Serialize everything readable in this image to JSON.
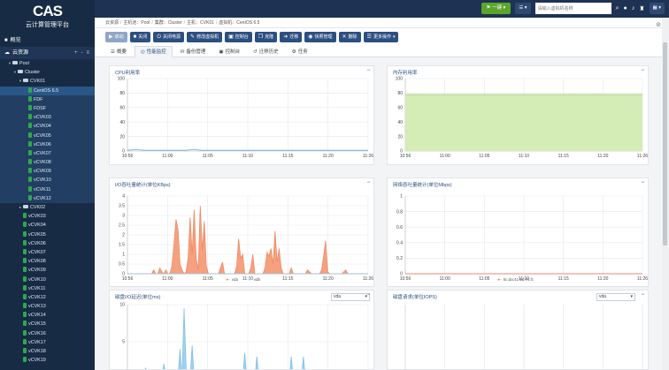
{
  "app": {
    "logo_mark": "CAS",
    "title": "云计算管理平台"
  },
  "nav": {
    "overview": "概览",
    "resources": "云资源",
    "add": "+",
    "minus": "-",
    "menu": "≡"
  },
  "tree": [
    {
      "label": "Pool",
      "level": 1,
      "type": "fold",
      "toggle": "▾"
    },
    {
      "label": "Cluster",
      "level": 2,
      "type": "fold",
      "toggle": "▾"
    },
    {
      "label": "CVK01",
      "level": 3,
      "type": "fold",
      "toggle": "▾"
    },
    {
      "label": "CentOS 6.5",
      "level": 4,
      "type": "vm",
      "selected": true
    },
    {
      "label": "FDF",
      "level": 4,
      "type": "vm",
      "highlight": true
    },
    {
      "label": "FDSF",
      "level": 4,
      "type": "vm",
      "highlight": true
    },
    {
      "label": "vCVK03",
      "level": 4,
      "type": "vm",
      "highlight": true
    },
    {
      "label": "vCVK04",
      "level": 4,
      "type": "vm",
      "highlight": true
    },
    {
      "label": "vCVK05",
      "level": 4,
      "type": "vm",
      "highlight": true
    },
    {
      "label": "vCVK06",
      "level": 4,
      "type": "vm",
      "highlight": true
    },
    {
      "label": "vCVK07",
      "level": 4,
      "type": "vm",
      "highlight": true
    },
    {
      "label": "vCVK08",
      "level": 4,
      "type": "vm",
      "highlight": true
    },
    {
      "label": "vCVK09",
      "level": 4,
      "type": "vm",
      "highlight": true
    },
    {
      "label": "vCVK10",
      "level": 4,
      "type": "vm",
      "highlight": true
    },
    {
      "label": "vCVK11",
      "level": 4,
      "type": "vm",
      "highlight": true
    },
    {
      "label": "vCVK12",
      "level": 4,
      "type": "vm",
      "highlight": true
    },
    {
      "label": "CVK02",
      "level": 3,
      "type": "fold",
      "toggle": "▸"
    },
    {
      "label": "vCVK03",
      "level": 3,
      "type": "vm"
    },
    {
      "label": "vCVK04",
      "level": 3,
      "type": "vm"
    },
    {
      "label": "vCVK05",
      "level": 3,
      "type": "vm"
    },
    {
      "label": "vCVK06",
      "level": 3,
      "type": "vm"
    },
    {
      "label": "vCVK07",
      "level": 3,
      "type": "vm"
    },
    {
      "label": "vCVK08",
      "level": 3,
      "type": "vm"
    },
    {
      "label": "vCVK09",
      "level": 3,
      "type": "vm"
    },
    {
      "label": "vCVK10",
      "level": 3,
      "type": "vm"
    },
    {
      "label": "vCVK11",
      "level": 3,
      "type": "vm"
    },
    {
      "label": "vCVK12",
      "level": 3,
      "type": "vm"
    },
    {
      "label": "vCVK13",
      "level": 3,
      "type": "vm"
    },
    {
      "label": "vCVK14",
      "level": 3,
      "type": "vm"
    },
    {
      "label": "vCVK15",
      "level": 3,
      "type": "vm"
    },
    {
      "label": "vCVK16",
      "level": 3,
      "type": "vm"
    },
    {
      "label": "vCVK17",
      "level": 3,
      "type": "vm"
    },
    {
      "label": "vCVK18",
      "level": 3,
      "type": "vm"
    },
    {
      "label": "vCVK19",
      "level": 3,
      "type": "vm"
    }
  ],
  "topbar": {
    "wizard_label": "一键",
    "view_label": "▾",
    "search_placeholder": "请输入虚拟机名称",
    "icons": [
      "search-icon",
      "user-icon",
      "bell-icon",
      "shirt-icon",
      "grid-icon"
    ]
  },
  "breadcrumb": [
    "云资源",
    "主机池：Pool",
    "集群：Cluster",
    "主机：CVK01",
    "虚拟机：CentOS 6.5"
  ],
  "actions": [
    {
      "label": "启动",
      "icon": "▶",
      "name": "start"
    },
    {
      "label": "关闭",
      "icon": "■",
      "name": "shutdown"
    },
    {
      "label": "关闭电源",
      "icon": "⏻",
      "name": "poweroff"
    },
    {
      "label": "修改虚拟机",
      "icon": "✎",
      "name": "modify"
    },
    {
      "label": "控制台",
      "icon": "▣",
      "name": "console"
    },
    {
      "label": "克隆",
      "icon": "❐",
      "name": "clone"
    },
    {
      "label": "迁移",
      "icon": "➜",
      "name": "migrate"
    },
    {
      "label": "快照管理",
      "icon": "◉",
      "name": "snapshot"
    },
    {
      "label": "删除",
      "icon": "✕",
      "name": "delete"
    },
    {
      "label": "更多操作",
      "icon": "☰",
      "name": "more"
    }
  ],
  "tabs": [
    {
      "label": "概要",
      "icon": "☰"
    },
    {
      "label": "性能监控",
      "icon": "◎",
      "active": true
    },
    {
      "label": "备份管理",
      "icon": "⛁"
    },
    {
      "label": "控制台",
      "icon": "▣"
    },
    {
      "label": "迁移历史",
      "icon": "↺"
    },
    {
      "label": "任务",
      "icon": "⚙"
    }
  ],
  "panels": {
    "cpu": {
      "title": "CPU利用率"
    },
    "mem": {
      "title": "内存利用率"
    },
    "io": {
      "title": "I/O吞吐量统计(单位KBps)"
    },
    "net": {
      "title": "网络吞吐量统计(单位Mbps)"
    },
    "lat": {
      "title": "磁盘I/O延迟(单位ms)",
      "select": "vda"
    },
    "iops": {
      "title": "磁盘请求(单位IOPS)",
      "select": "vda"
    },
    "more": "···"
  },
  "colors": {
    "cpu": "#6fa8dc",
    "mem_fill": "#d4ecb6",
    "mem_line": "#a7cf7a",
    "vda": "#f5a17f",
    "vdb": "#8ecbe8",
    "net": "#e2725b",
    "lat": "#9fd3f0"
  },
  "chart_data": [
    {
      "type": "line",
      "title": "CPU利用率",
      "x": [
        "10:56",
        "11:00",
        "11:05",
        "11:10",
        "11:15",
        "11:20",
        "11:26"
      ],
      "yticks": [
        "0",
        "20",
        "40",
        "60",
        "80",
        "100"
      ],
      "ylim": [
        0,
        100
      ],
      "series": [
        {
          "values": [
            1,
            2,
            1,
            1,
            1,
            1,
            1,
            1,
            2,
            1,
            1,
            1,
            1,
            1,
            1,
            1,
            1,
            1,
            1,
            1,
            1,
            1,
            1,
            1,
            1,
            1,
            1,
            1,
            1,
            1
          ]
        }
      ]
    },
    {
      "type": "area",
      "title": "内存利用率",
      "x": [
        "10:56",
        "11:00",
        "11:05",
        "11:10",
        "11:15",
        "11:20",
        "11:26"
      ],
      "yticks": [
        "0",
        "20",
        "40",
        "60",
        "80",
        "100"
      ],
      "ylim": [
        0,
        100
      ],
      "series": [
        {
          "values": [
            78,
            78,
            78,
            78,
            78,
            78,
            78,
            78,
            78,
            78,
            78,
            78,
            78,
            78,
            78,
            78,
            78,
            78,
            78,
            78,
            78,
            78,
            78,
            78,
            78,
            78,
            78,
            78,
            78,
            78
          ]
        }
      ]
    },
    {
      "type": "area",
      "title": "I/O吞吐量统计(单位KBps)",
      "x": [
        "10:56",
        "11:00",
        "11:05",
        "11:10",
        "11:15",
        "11:20",
        "11:26"
      ],
      "yticks": [
        "0",
        "0.5",
        "1",
        "1.5",
        "2",
        "2.5",
        "3",
        "3.5",
        "4"
      ],
      "ylim": [
        0,
        4
      ],
      "series": [
        {
          "name": "vda",
          "values": [
            0,
            0,
            0,
            0,
            0,
            0,
            0,
            0,
            0,
            0,
            0,
            0,
            0,
            0.2,
            0,
            0,
            0.3,
            0.1,
            0,
            0.2,
            0,
            0,
            0.4,
            1.5,
            2.8,
            2.3,
            0.5,
            0.2,
            0,
            0.1,
            0.8,
            2.9,
            1.0,
            3.3,
            0.8,
            0.2,
            3.5,
            1.2,
            2.7,
            0.4,
            0,
            0,
            0,
            0,
            0,
            0,
            0.3,
            0.6,
            0,
            0,
            0,
            0,
            0,
            0,
            0.4,
            1.8,
            0.8,
            1.0,
            0,
            0,
            0,
            0.3,
            1.0,
            0,
            0,
            0,
            0,
            0,
            0.3,
            1.1,
            0.9,
            1.3,
            0.5,
            2.2,
            0.6,
            1.3,
            0.3,
            0,
            0,
            0,
            0,
            0.3,
            0,
            0,
            0,
            0,
            0,
            0,
            0,
            0.2,
            0.1,
            0,
            0,
            0,
            0,
            0,
            0.2,
            0.9,
            1.7,
            0.1,
            0,
            0,
            0,
            0,
            0,
            0,
            0,
            0.1,
            0.2,
            0,
            0,
            0,
            0,
            0,
            0,
            0,
            0,
            0,
            0,
            0
          ]
        },
        {
          "name": "vdb",
          "values": [
            0,
            0,
            0,
            0,
            0,
            0,
            0,
            0,
            0,
            0,
            0,
            0,
            0,
            0,
            0,
            0,
            0,
            0,
            0,
            0,
            0,
            0,
            0,
            0,
            0,
            0,
            0,
            0,
            0,
            0,
            0,
            0,
            0,
            0,
            0,
            0,
            0,
            0,
            0,
            0,
            0,
            0,
            0,
            0,
            0,
            0,
            0,
            0,
            0,
            0,
            0,
            0,
            0,
            0,
            0,
            0,
            0,
            0,
            0,
            0,
            0,
            0,
            0,
            0,
            0,
            0,
            0,
            0,
            0,
            0,
            0,
            0,
            0,
            0,
            0,
            0,
            0,
            0,
            0,
            0,
            0,
            0,
            0,
            0,
            0,
            0,
            0,
            0,
            0,
            0,
            0,
            0,
            0,
            0,
            0,
            0,
            0,
            0,
            0,
            0,
            0,
            0,
            0,
            0,
            0,
            0,
            0,
            0,
            0,
            0,
            0,
            0,
            0,
            0,
            0,
            0,
            0,
            0,
            0,
            0
          ]
        }
      ]
    },
    {
      "type": "line",
      "title": "网络吞吐量统计(单位Mbps)",
      "x": [
        "10:56",
        "11:00",
        "11:05",
        "11:10",
        "11:15",
        "11:20",
        "11:26"
      ],
      "yticks": [
        "0",
        "0.2",
        "0.4",
        "0.6",
        "0.8",
        "1"
      ],
      "ylim": [
        0,
        1
      ],
      "series": [
        {
          "name": "0c:da:41:1d:7c:fc",
          "values": [
            0,
            0,
            0,
            0,
            0,
            0,
            0,
            0,
            0,
            0,
            0,
            0,
            0,
            0,
            0,
            0,
            0,
            0,
            0,
            0,
            0,
            0,
            0,
            0,
            0,
            0,
            0,
            0,
            0,
            0
          ]
        }
      ]
    },
    {
      "type": "area",
      "title": "磁盘I/O延迟(单位ms)",
      "x": [
        "10:56",
        "11:00",
        "11:05",
        "11:10",
        "11:15",
        "11:20",
        "11:26"
      ],
      "yticks": [
        "0",
        "5",
        "10"
      ],
      "ylim": [
        0,
        10
      ],
      "series": [
        {
          "values": [
            0,
            0,
            0,
            0,
            0,
            0,
            0,
            0,
            0,
            1.5,
            0,
            0,
            0.3,
            0,
            0,
            0,
            0,
            0,
            2,
            0.5,
            0,
            0,
            0,
            1,
            0,
            0,
            4,
            0,
            9.5,
            1.5,
            0,
            0,
            4.5,
            0,
            0,
            0,
            0,
            0,
            0,
            0,
            0,
            0,
            0,
            0,
            0,
            0,
            0,
            0,
            0,
            0,
            0,
            0,
            0,
            0,
            0,
            0,
            0,
            0,
            3.5,
            0,
            0,
            0,
            0,
            0,
            3,
            0,
            0,
            0,
            0,
            0,
            0,
            0,
            0,
            0,
            0,
            0,
            0,
            0,
            0,
            1,
            0,
            3,
            0,
            1,
            0,
            0,
            0,
            3,
            0,
            0,
            0,
            0,
            0,
            0,
            0,
            0,
            0,
            0,
            0,
            0,
            0,
            0,
            0,
            0,
            0,
            0,
            0,
            0,
            0,
            0,
            0,
            0,
            0,
            0,
            0,
            0,
            0,
            0,
            0,
            0
          ]
        }
      ]
    },
    {
      "type": "line",
      "title": "磁盘请求(单位IOPS)",
      "x": [
        "10:56",
        "11:00",
        "11:05",
        "11:10",
        "11:15",
        "11:20",
        "11:26"
      ],
      "yticks": [],
      "ylim": [
        0,
        1
      ],
      "series": []
    }
  ]
}
